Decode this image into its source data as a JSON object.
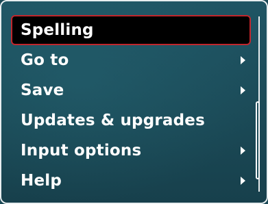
{
  "menu": {
    "items": [
      {
        "label": "Spelling",
        "selected": true,
        "has_submenu": false
      },
      {
        "label": "Go to",
        "selected": false,
        "has_submenu": true
      },
      {
        "label": "Save",
        "selected": false,
        "has_submenu": true
      },
      {
        "label": "Updates & upgrades",
        "selected": false,
        "has_submenu": false
      },
      {
        "label": "Input options",
        "selected": false,
        "has_submenu": true
      },
      {
        "label": "Help",
        "selected": false,
        "has_submenu": true
      }
    ]
  },
  "colors": {
    "background": "#1c4a57",
    "selection_fill": "#000000",
    "selection_border": "#c1262c",
    "text": "#ffffff"
  },
  "icons": {
    "submenu": "chevron-right-icon"
  }
}
